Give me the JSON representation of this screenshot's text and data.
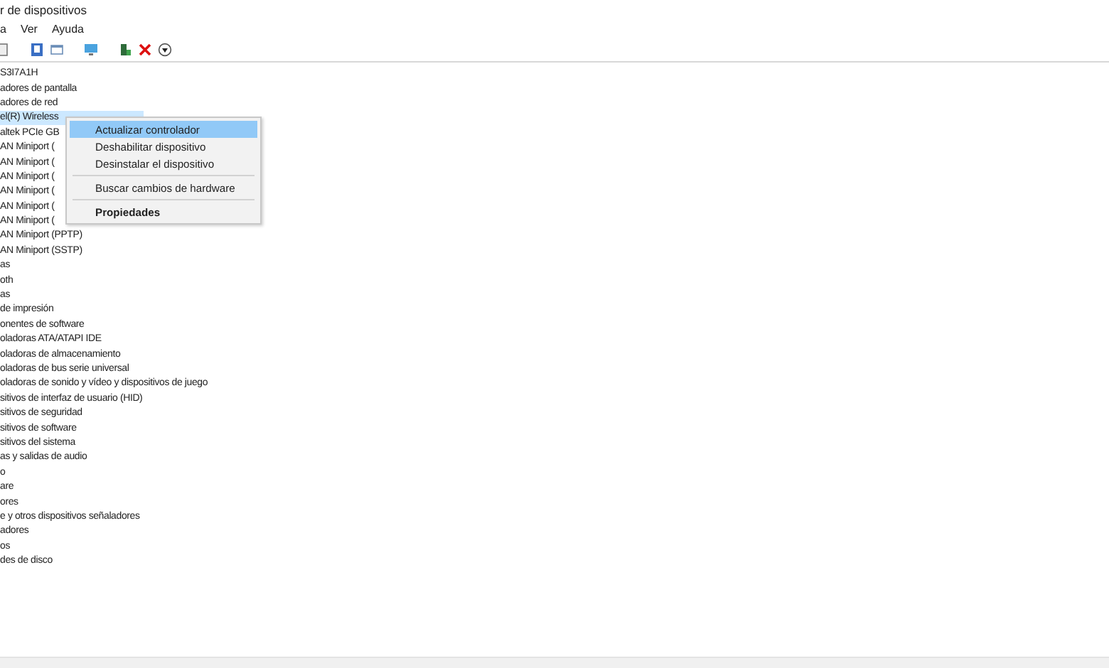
{
  "window": {
    "title": "r de dispositivos"
  },
  "menu_bar": [
    "a",
    "Ver",
    "Ayuda"
  ],
  "tree": [
    {
      "label": "S3I7A1H",
      "selected": false,
      "children": [
        {
          "label": "adores de pantalla",
          "selected": false
        },
        {
          "label": "adores de red",
          "selected": false,
          "children": [
            {
              "label": "el(R) Wireless",
              "selected": true
            },
            {
              "label": "altek PCIe GB",
              "selected": false
            },
            {
              "label": "AN Miniport (",
              "selected": false
            },
            {
              "label": "AN Miniport (",
              "selected": false
            },
            {
              "label": "AN Miniport (",
              "selected": false
            },
            {
              "label": "AN Miniport (",
              "selected": false
            },
            {
              "label": "AN Miniport (",
              "selected": false
            },
            {
              "label": "AN Miniport (",
              "selected": false
            },
            {
              "label": "AN Miniport (PPTP)",
              "selected": false
            },
            {
              "label": "AN Miniport (SSTP)",
              "selected": false
            }
          ]
        },
        {
          "label": "as",
          "selected": false
        },
        {
          "label": "oth",
          "selected": false
        },
        {
          "label": "as",
          "selected": false
        },
        {
          "label": "de impresión",
          "selected": false
        },
        {
          "label": "onentes de software",
          "selected": false
        },
        {
          "label": "oladoras ATA/ATAPI IDE",
          "selected": false
        },
        {
          "label": "oladoras de almacenamiento",
          "selected": false
        },
        {
          "label": "oladoras de bus serie universal",
          "selected": false
        },
        {
          "label": "oladoras de sonido y vídeo y dispositivos de juego",
          "selected": false
        },
        {
          "label": "sitivos de interfaz de usuario (HID)",
          "selected": false
        },
        {
          "label": "sitivos de seguridad",
          "selected": false
        },
        {
          "label": "sitivos de software",
          "selected": false
        },
        {
          "label": "sitivos del sistema",
          "selected": false
        },
        {
          "label": "as y salidas de audio",
          "selected": false
        },
        {
          "label": "o",
          "selected": false
        },
        {
          "label": "are",
          "selected": false
        },
        {
          "label": "ores",
          "selected": false
        },
        {
          "label": "e y otros dispositivos señaladores",
          "selected": false
        },
        {
          "label": "adores",
          "selected": false
        },
        {
          "label": "os",
          "selected": false
        },
        {
          "label": "des de disco",
          "selected": false
        }
      ]
    }
  ],
  "context_menu": [
    {
      "kind": "item",
      "label": "Actualizar controlador",
      "selected": true,
      "default": false
    },
    {
      "kind": "item",
      "label": "Deshabilitar dispositivo",
      "selected": false,
      "default": false
    },
    {
      "kind": "item",
      "label": "Desinstalar el dispositivo",
      "selected": false,
      "default": false
    },
    {
      "kind": "separator"
    },
    {
      "kind": "item",
      "label": "Buscar cambios de hardware",
      "selected": false,
      "default": false
    },
    {
      "kind": "separator"
    },
    {
      "kind": "item",
      "label": "Propiedades",
      "selected": false,
      "default": true
    }
  ]
}
